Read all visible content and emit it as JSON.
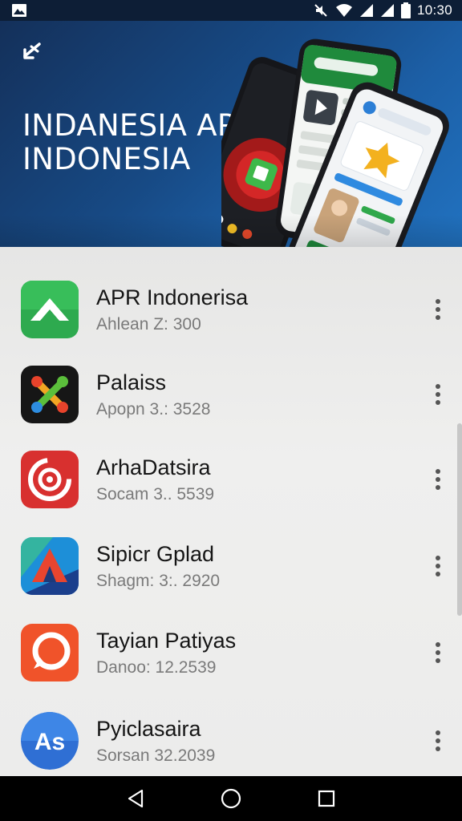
{
  "status_bar": {
    "time": "10:30",
    "icons": [
      "gallery-notification-icon",
      "mute-icon",
      "wifi-icon",
      "signal-icon",
      "signal-icon",
      "battery-icon"
    ]
  },
  "banner": {
    "title_line1": "INDANESIA APK",
    "title_line2": "INDONESIA",
    "back_icon": "back-arrow-icon"
  },
  "apps": [
    {
      "name": "APR Indonerisa",
      "subtitle": "Ahlean Z: 300",
      "icon": "chevron-up-green-icon",
      "color": "#2eaa4f"
    },
    {
      "name": "Palaiss",
      "subtitle": "Apopn 3.: 3528",
      "icon": "x-links-icon",
      "color": "#161616"
    },
    {
      "name": "ArhaDatsira",
      "subtitle": "Socam 3.. 5539",
      "icon": "target-red-icon",
      "color": "#d8302f"
    },
    {
      "name": "Sipicr Gplad",
      "subtitle": "Shagm: 3:. 2920",
      "icon": "map-triangle-icon",
      "color": "#1d8fd8"
    },
    {
      "name": "Tayian Patiyas",
      "subtitle": "Danoo: 12.2539",
      "icon": "chat-bubble-orange-icon",
      "color": "#f0532a"
    },
    {
      "name": "Pyiclasaira",
      "subtitle": "Sorsan 32.2039",
      "icon": "as-logo-icon",
      "color": "#2f6fd4"
    }
  ],
  "nav": {
    "back_icon": "triangle-back-icon",
    "home_icon": "circle-home-icon",
    "recents_icon": "square-recents-icon"
  }
}
